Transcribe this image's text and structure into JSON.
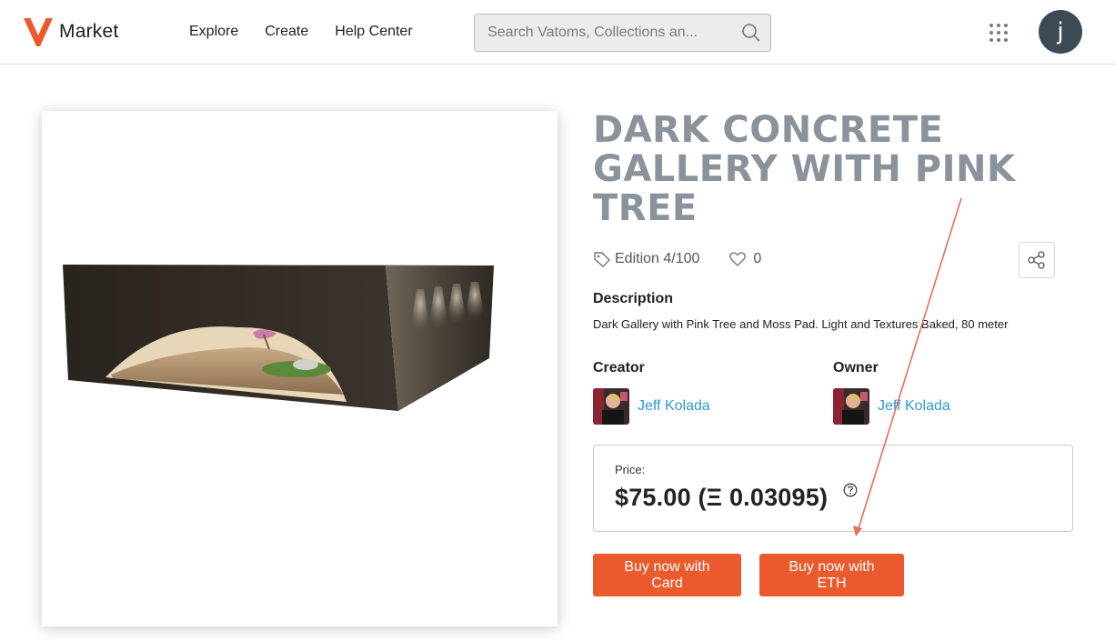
{
  "header": {
    "logo_text": "Market",
    "nav": [
      "Explore",
      "Create",
      "Help Center"
    ],
    "search_placeholder": "Search Vatoms, Collections an...",
    "avatar_initial": "j"
  },
  "item": {
    "title": "DARK CONCRETE GALLERY WITH PINK TREE",
    "edition": "Edition 4/100",
    "likes": "0",
    "description_label": "Description",
    "description": "Dark Gallery with Pink Tree and Moss Pad. Light and Textures Baked, 80 meter",
    "creator_label": "Creator",
    "creator_name": "Jeff Kolada",
    "owner_label": "Owner",
    "owner_name": "Jeff Kolada",
    "price_label": "Price:",
    "price_value": "$75.00 (Ξ 0.03095)",
    "buy_card_label": "Buy now with Card",
    "buy_eth_label": "Buy now with ETH"
  },
  "colors": {
    "accent": "#ea5a2d",
    "title": "#8a929c",
    "link": "#2f97d6",
    "annotation_arrow": "#ea6a5e"
  },
  "icons": [
    "logo-v-icon",
    "search-icon",
    "apps-grid-icon",
    "tag-icon",
    "heart-icon",
    "share-icon",
    "help-circle-icon"
  ]
}
